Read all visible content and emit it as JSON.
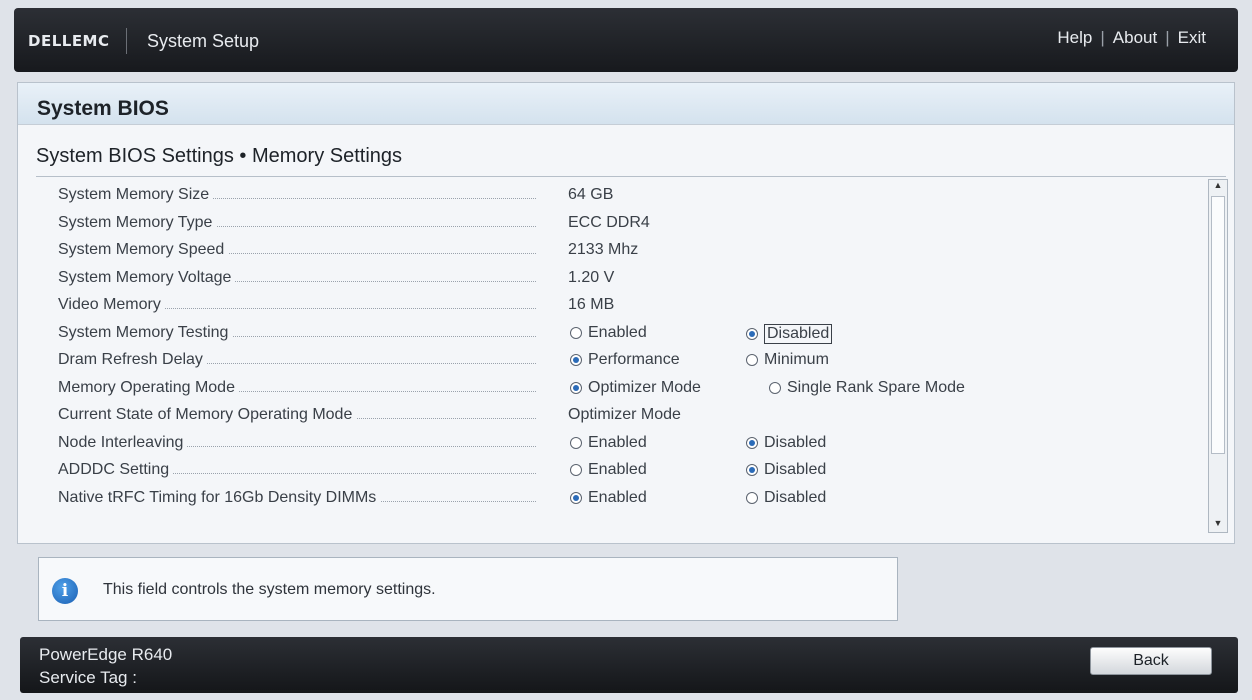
{
  "header": {
    "logo": "DELLEMC",
    "title": "System Setup",
    "nav": [
      "Help",
      "About",
      "Exit"
    ]
  },
  "panel": {
    "title": "System BIOS",
    "breadcrumb": "System BIOS Settings • Memory Settings"
  },
  "settings": [
    {
      "label": "System Memory Size",
      "value": "64 GB"
    },
    {
      "label": "System Memory Type",
      "value": "ECC DDR4"
    },
    {
      "label": "System Memory Speed",
      "value": "2133 Mhz"
    },
    {
      "label": "System Memory Voltage",
      "value": "1.20 V"
    },
    {
      "label": "Video Memory",
      "value": "16 MB"
    },
    {
      "label": "System Memory Testing",
      "options": [
        "Enabled",
        "Disabled"
      ],
      "selected": "Disabled"
    },
    {
      "label": "Dram Refresh Delay",
      "options": [
        "Performance",
        "Minimum"
      ],
      "selected": "Performance"
    },
    {
      "label": "Memory Operating Mode",
      "options": [
        "Optimizer Mode",
        "Single Rank Spare Mode"
      ],
      "selected": "Optimizer Mode"
    },
    {
      "label": "Current State of Memory Operating Mode",
      "value": "Optimizer Mode"
    },
    {
      "label": "Node Interleaving",
      "options": [
        "Enabled",
        "Disabled"
      ],
      "selected": "Disabled"
    },
    {
      "label": "ADDDC Setting",
      "options": [
        "Enabled",
        "Disabled"
      ],
      "selected": "Disabled"
    },
    {
      "label": "Native tRFC Timing for 16Gb Density DIMMs",
      "options": [
        "Enabled",
        "Disabled"
      ],
      "selected": "Enabled"
    }
  ],
  "help": {
    "icon": "info-icon",
    "message": "This field controls the system memory settings."
  },
  "footer": {
    "model": "PowerEdge R640",
    "service_tag_label": "Service Tag :",
    "back_label": "Back"
  },
  "colors": {
    "header_bg": "#1f2226",
    "accent": "#2b6bb8",
    "panel_bg": "#f4f6f9"
  }
}
